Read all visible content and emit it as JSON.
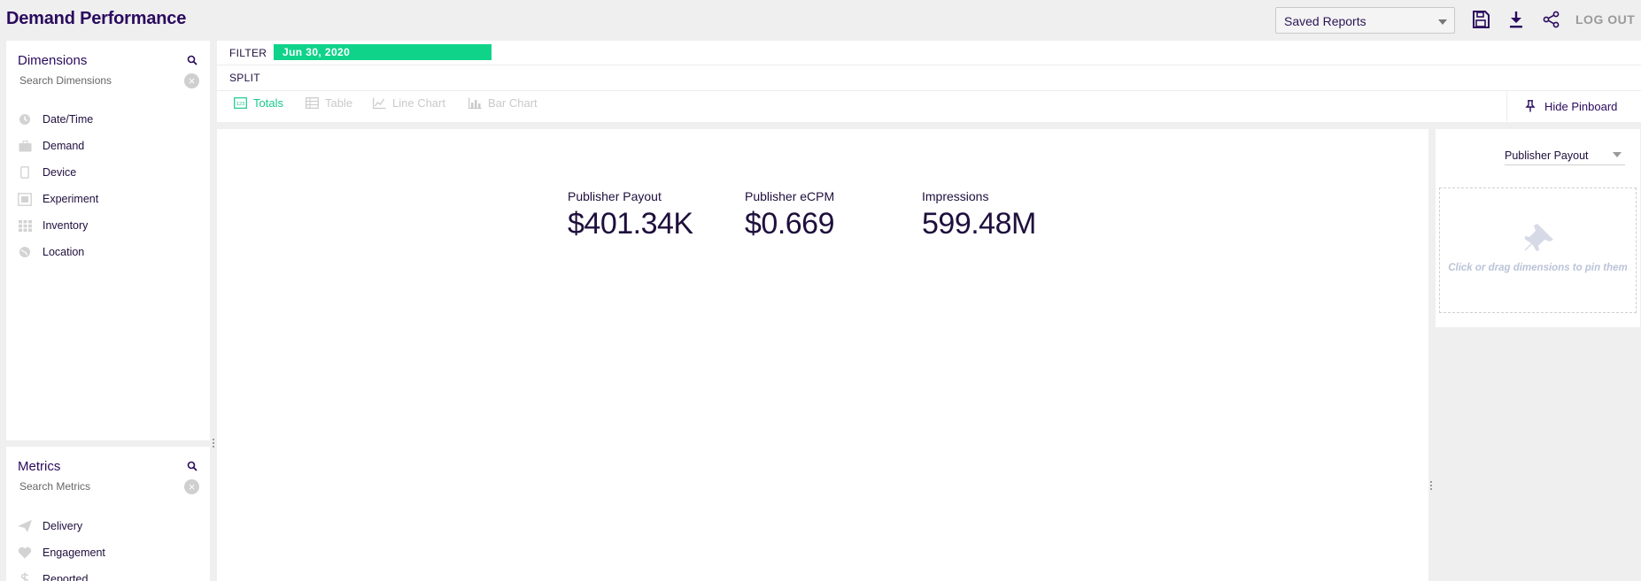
{
  "app": {
    "title": "Demand Performance"
  },
  "toolbar": {
    "saved_reports": "Saved Reports",
    "save_icon": "save-icon",
    "download_icon": "download-icon",
    "share_icon": "share-icon",
    "logout": "LOG OUT"
  },
  "dimensions": {
    "title": "Dimensions",
    "search_placeholder": "Search Dimensions",
    "items": [
      {
        "label": "Date/Time",
        "icon": "clock-icon"
      },
      {
        "label": "Demand",
        "icon": "briefcase-icon"
      },
      {
        "label": "Device",
        "icon": "device-icon"
      },
      {
        "label": "Experiment",
        "icon": "experiment-icon"
      },
      {
        "label": "Inventory",
        "icon": "grid-icon"
      },
      {
        "label": "Location",
        "icon": "globe-icon"
      }
    ]
  },
  "metrics": {
    "title": "Metrics",
    "search_placeholder": "Search Metrics",
    "items": [
      {
        "label": "Delivery",
        "icon": "paper-plane-icon"
      },
      {
        "label": "Engagement",
        "icon": "heart-icon"
      },
      {
        "label": "Reported",
        "icon": "dollar-icon"
      }
    ]
  },
  "filterbar": {
    "filter_label": "FILTER",
    "filter_value": "Jun 30, 2020",
    "split_label": "SPLIT",
    "tabs": [
      {
        "label": "Totals",
        "active": true
      },
      {
        "label": "Table",
        "active": false
      },
      {
        "label": "Line Chart",
        "active": false
      },
      {
        "label": "Bar Chart",
        "active": false
      }
    ],
    "hide_pinboard": "Hide Pinboard"
  },
  "totals": [
    {
      "label": "Publisher Payout",
      "value": "$401.34K"
    },
    {
      "label": "Publisher eCPM",
      "value": "$0.669"
    },
    {
      "label": "Impressions",
      "value": "599.48M"
    }
  ],
  "pinboard": {
    "metric_select": "Publisher Payout",
    "drop_hint": "Click or drag dimensions to pin them"
  },
  "colors": {
    "accent": "#10d38a",
    "primary": "#2a0a5e",
    "inactive": "#c9c9c9"
  }
}
